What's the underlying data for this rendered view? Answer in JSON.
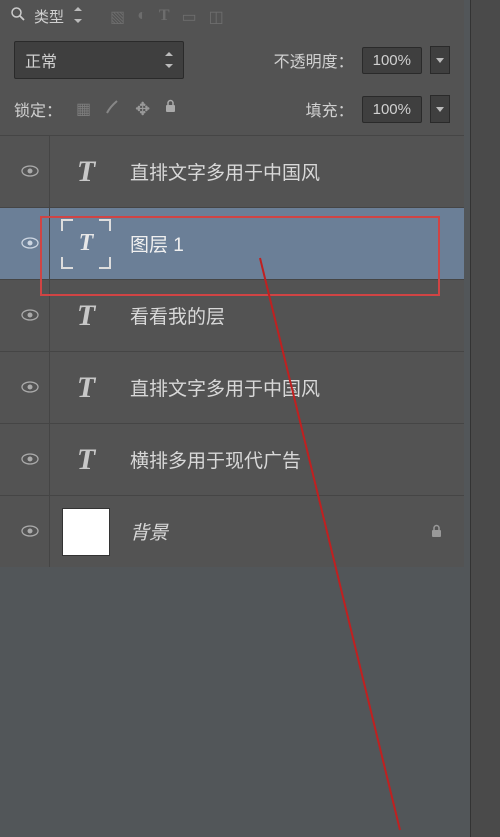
{
  "top": {
    "type_label": "类型"
  },
  "blend": {
    "mode": "正常",
    "opacity_label": "不透明度：",
    "opacity_value": "100%"
  },
  "lock": {
    "label": "锁定：",
    "fill_label": "填充：",
    "fill_value": "100%"
  },
  "layers": [
    {
      "name": "直排文字多用于中国风",
      "type": "text",
      "selected": false,
      "locked": false
    },
    {
      "name": "图层 1",
      "type": "text-selection",
      "selected": true,
      "locked": false
    },
    {
      "name": "看看我的层",
      "type": "text",
      "selected": false,
      "locked": false
    },
    {
      "name": "直排文字多用于中国风",
      "type": "text",
      "selected": false,
      "locked": false
    },
    {
      "name": "横排多用于现代广告",
      "type": "text",
      "selected": false,
      "locked": false
    },
    {
      "name": "背景",
      "type": "bg",
      "selected": false,
      "locked": true
    }
  ]
}
